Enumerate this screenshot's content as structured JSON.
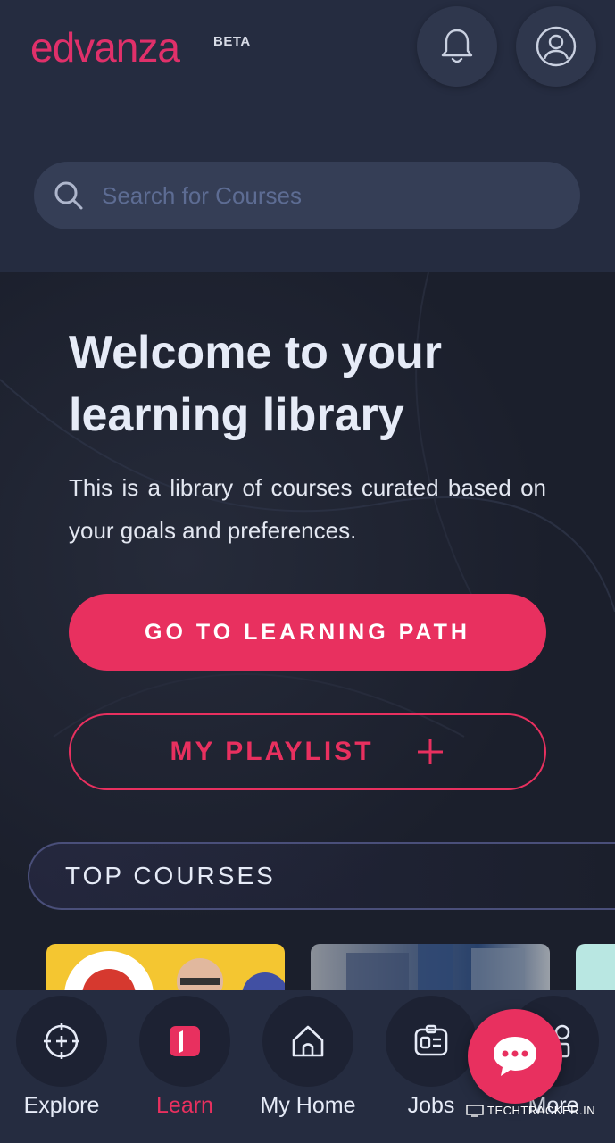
{
  "header": {
    "logo": "edvanza",
    "beta": "BETA",
    "bell_icon": "bell-icon",
    "user_icon": "user-circle-icon"
  },
  "search": {
    "placeholder": "Search for Courses",
    "icon": "search-icon"
  },
  "hero": {
    "title": "Welcome to your learning library",
    "description": "This is a library of courses curated based on your goals and preferences.",
    "primary_button": "GO TO LEARNING PATH",
    "playlist_button": "MY PLAYLIST"
  },
  "top_courses": {
    "label": "TOP COURSES"
  },
  "bottom_nav": {
    "items": [
      {
        "label": "Explore",
        "icon": "compass-icon"
      },
      {
        "label": "Learn",
        "icon": "book-icon",
        "active": true
      },
      {
        "label": "My Home",
        "icon": "home-icon"
      },
      {
        "label": "Jobs",
        "icon": "id-badge-icon"
      },
      {
        "label": "More",
        "icon": "grid-icon"
      }
    ]
  },
  "chat": {
    "icon": "chat-bubble-icon"
  },
  "watermark": "TECHTRACKER.IN",
  "colors": {
    "accent": "#e8305f",
    "header_bg": "#252c40",
    "page_bg": "#1b1f2c"
  }
}
